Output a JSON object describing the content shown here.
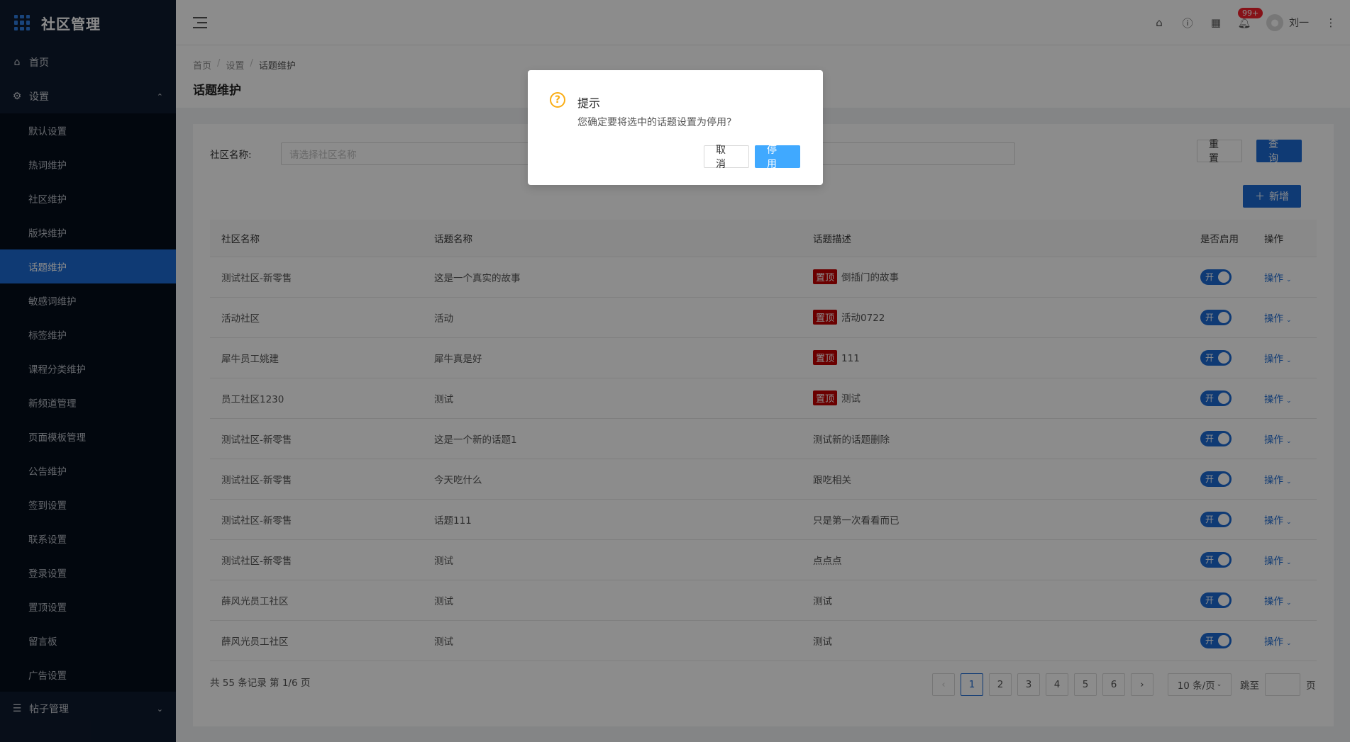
{
  "app": {
    "title": "社区管理"
  },
  "sidebar": {
    "home": "首页",
    "settings": "设置",
    "settings_items": [
      "默认设置",
      "热词维护",
      "社区维护",
      "版块维护",
      "话题维护",
      "敏感词维护",
      "标签维护",
      "课程分类维护",
      "新频道管理",
      "页面模板管理",
      "公告维护",
      "签到设置",
      "联系设置",
      "登录设置",
      "置顶设置",
      "留言板",
      "广告设置"
    ],
    "active_item": "话题维护",
    "posts": "帖子管理"
  },
  "header": {
    "notification_badge": "99+",
    "user_name": "刘一"
  },
  "breadcrumb": [
    "首页",
    "设置",
    "话题维护"
  ],
  "page_title": "话题维护",
  "filter": {
    "label": "社区名称:",
    "placeholder": "请选择社区名称",
    "reset": "重置",
    "query": "查询",
    "add": "新增"
  },
  "table": {
    "columns": [
      "社区名称",
      "话题名称",
      "话题描述",
      "是否启用",
      "操作"
    ],
    "top_tag": "置顶",
    "switch_on": "开",
    "op_label": "操作",
    "rows": [
      {
        "community": "测试社区-新零售",
        "topic": "这是一个真实的故事",
        "top": true,
        "desc": "倒插门的故事"
      },
      {
        "community": "活动社区",
        "topic": "活动",
        "top": true,
        "desc": "活动0722"
      },
      {
        "community": "犀牛员工姚建",
        "topic": "犀牛真是好",
        "top": true,
        "desc": "111"
      },
      {
        "community": "员工社区1230",
        "topic": "测试",
        "top": true,
        "desc": "测试"
      },
      {
        "community": "测试社区-新零售",
        "topic": "这是一个新的话题1",
        "top": false,
        "desc": "测试新的话题删除"
      },
      {
        "community": "测试社区-新零售",
        "topic": "今天吃什么",
        "top": false,
        "desc": "跟吃相关"
      },
      {
        "community": "测试社区-新零售",
        "topic": "话题111",
        "top": false,
        "desc": "只是第一次看看而已"
      },
      {
        "community": "测试社区-新零售",
        "topic": "测试",
        "top": false,
        "desc": "点点点"
      },
      {
        "community": "薛风光员工社区",
        "topic": "测试",
        "top": false,
        "desc": "测试"
      },
      {
        "community": "薛风光员工社区",
        "topic": "测试",
        "top": false,
        "desc": "测试"
      }
    ]
  },
  "pagination": {
    "total_text": "共 55 条记录 第 1/6 页",
    "pages": [
      "1",
      "2",
      "3",
      "4",
      "5",
      "6"
    ],
    "current": "1",
    "page_size": "10 条/页",
    "jump_label": "跳至",
    "page_suffix": "页"
  },
  "dialog": {
    "title": "提示",
    "message": "您确定要将选中的话题设置为停用?",
    "cancel": "取消",
    "confirm": "停用"
  },
  "colors": {
    "sidebar_bg": "#0e1a2e",
    "primary": "#1d6bd3",
    "top_tag": "#c30000",
    "warning": "#faad14"
  }
}
